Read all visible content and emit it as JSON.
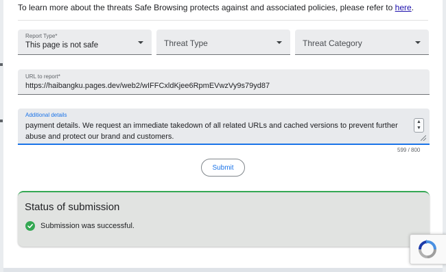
{
  "info": {
    "text": "To learn more about the threats Safe Browsing protects against and associated policies, please refer to ",
    "link_label": "here",
    "suffix": "."
  },
  "form": {
    "report_type": {
      "label": "Report Type*",
      "value": "This page is not safe"
    },
    "threat_type": {
      "placeholder": "Threat Type"
    },
    "threat_category": {
      "placeholder": "Threat Category"
    },
    "url": {
      "label": "URL to report*",
      "value": "https://haibangku.pages.dev/web2/wIFFCxldKjee6RpmEVwzVy9s79yd87"
    },
    "details": {
      "label": "Additional details",
      "value": "payment details. We request an immediate takedown of all related URLs and cached versions to prevent further abuse and protect our brand and customers.",
      "counter": "599 / 800"
    },
    "submit_label": "Submit"
  },
  "status": {
    "title": "Status of submission",
    "message": "Submission was successful.",
    "color": "#34a853"
  },
  "recaptcha": {
    "icon": "recaptcha-logo"
  }
}
